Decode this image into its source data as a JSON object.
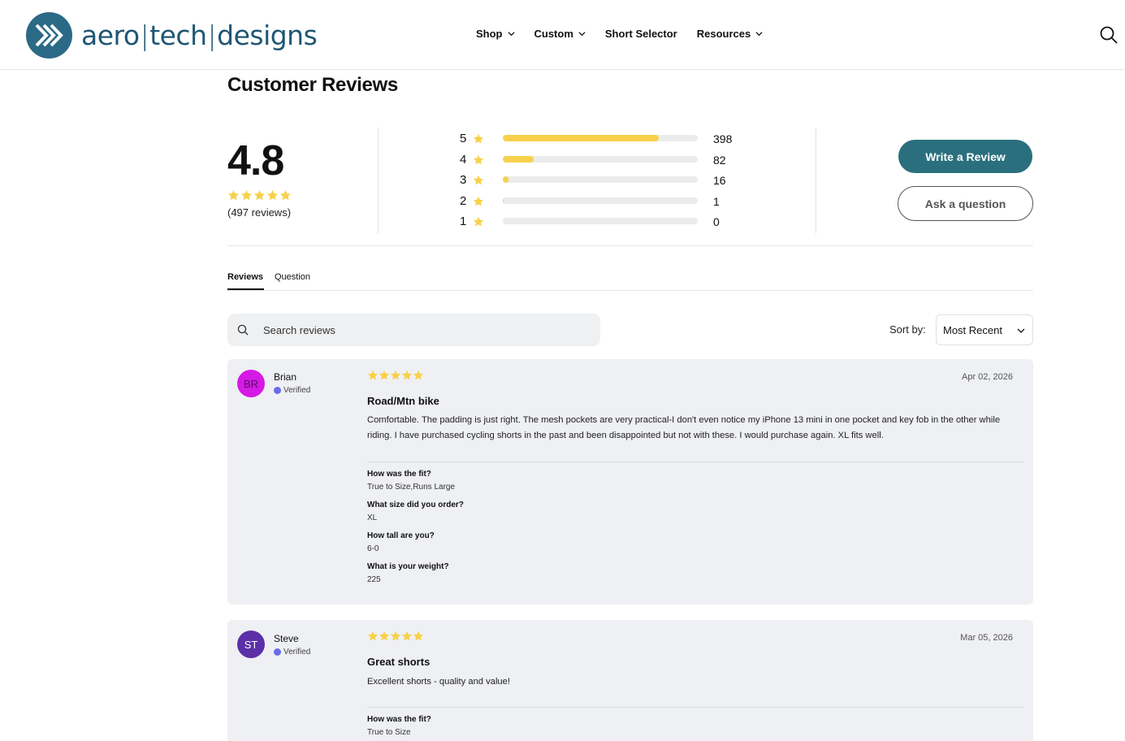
{
  "header": {
    "logo_text": [
      "aero",
      "tech",
      "designs"
    ],
    "nav": [
      {
        "label": "Shop",
        "has_dropdown": true
      },
      {
        "label": "Custom",
        "has_dropdown": true
      },
      {
        "label": "Short Selector",
        "has_dropdown": false
      },
      {
        "label": "Resources",
        "has_dropdown": true
      }
    ],
    "search_icon": "search-icon"
  },
  "page": {
    "title": "Customer Reviews"
  },
  "summary": {
    "average": "4.8",
    "stars": 5,
    "count_text": "(497 reviews)",
    "distribution": [
      {
        "rating": "5",
        "count": "398",
        "fraction": 0.8
      },
      {
        "rating": "4",
        "count": "82",
        "fraction": 0.16
      },
      {
        "rating": "3",
        "count": "16",
        "fraction": 0.03
      },
      {
        "rating": "2",
        "count": "1",
        "fraction": 0.003
      },
      {
        "rating": "1",
        "count": "0",
        "fraction": 0
      }
    ],
    "write_button": "Write a Review",
    "ask_button": "Ask a question"
  },
  "tabs": {
    "reviews": "Reviews",
    "question": "Question"
  },
  "toolbar": {
    "search_placeholder": "Search reviews",
    "sort_label": "Sort by:",
    "sort_value": "Most Recent"
  },
  "reviews": [
    {
      "initials": "BR",
      "avatar_color": "#d519e6",
      "avatar_text_color": "#5a1060",
      "name": "Brian",
      "verified": "Verified",
      "rating": 5,
      "date": "Apr 02, 2026",
      "title": "Road/Mtn bike",
      "body": "Comfortable. The padding is just right. The mesh pockets are very practical-I don't even notice my iPhone 13 mini in one pocket and key fob in the other while riding. I have purchased cycling shorts in the past and been disappointed but not with these. I would purchase again. XL fits well.",
      "qa": [
        {
          "q": "How was the fit?",
          "a": "True to Size,Runs Large"
        },
        {
          "q": "What size did you order?",
          "a": "XL"
        },
        {
          "q": "How tall are you?",
          "a": "6-0"
        },
        {
          "q": "What is your weight?",
          "a": "225"
        }
      ]
    },
    {
      "initials": "ST",
      "avatar_color": "#5b2fa8",
      "avatar_text_color": "#ffffff",
      "name": "Steve",
      "verified": "Verified",
      "rating": 5,
      "date": "Mar 05, 2026",
      "title": "Great shorts",
      "body": "Excellent shorts - quality and value!",
      "qa": [
        {
          "q": "How was the fit?",
          "a": "True to Size"
        }
      ]
    }
  ],
  "colors": {
    "star": "#f7d14b",
    "primary": "#2b6f7e",
    "brand": "#1f5674"
  }
}
